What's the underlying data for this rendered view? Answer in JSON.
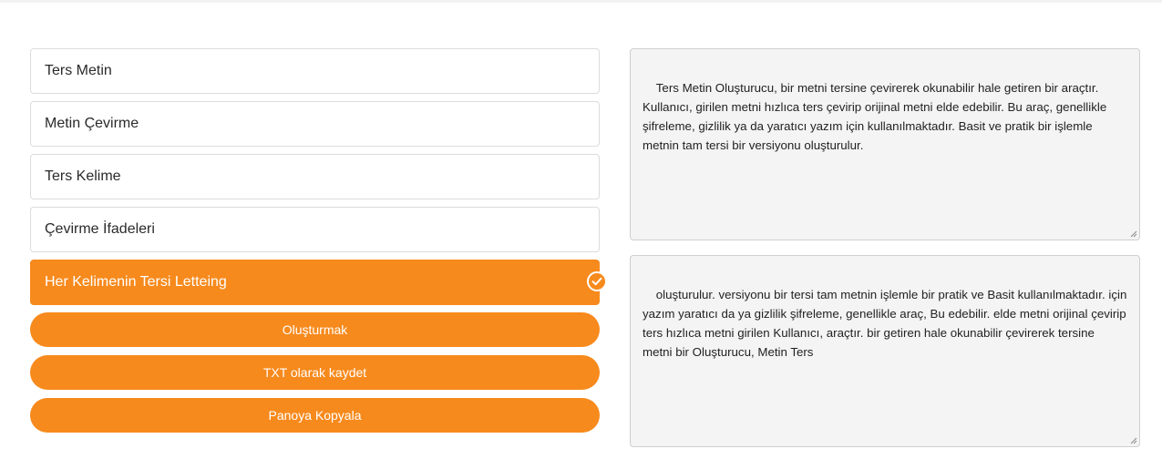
{
  "options": [
    {
      "label": "Ters Metin",
      "selected": false
    },
    {
      "label": "Metin Çevirme",
      "selected": false
    },
    {
      "label": "Ters Kelime",
      "selected": false
    },
    {
      "label": "Çevirme İfadeleri",
      "selected": false
    },
    {
      "label": "Her Kelimenin Tersi Letteing",
      "selected": true
    }
  ],
  "buttons": {
    "generate": "Oluşturmak",
    "save_txt": "TXT olarak kaydet",
    "copy": "Panoya Kopyala"
  },
  "input_text": "Ters Metin Oluşturucu, bir metni tersine çevirerek okunabilir hale getiren bir araçtır. Kullanıcı, girilen metni hızlıca ters çevirip orijinal metni elde edebilir. Bu araç, genellikle şifreleme, gizlilik ya da yaratıcı yazım için kullanılmaktadır. Basit ve pratik bir işlemle metnin tam tersi bir versiyonu oluşturulur.",
  "output_text": "oluşturulur. versiyonu bir tersi tam metnin işlemle bir pratik ve Basit kullanılmaktadır. için yazım yaratıcı da ya gizlilik şifreleme, genellikle araç, Bu edebilir. elde metni orijinal çevirip ters hızlıca metni girilen Kullanıcı, araçtır. bir getiren hale okunabilir çevirerek tersine metni bir Oluşturucu, Metin Ters",
  "colors": {
    "accent": "#f78a1d"
  },
  "icons": {
    "selected": "check-circle-icon"
  }
}
